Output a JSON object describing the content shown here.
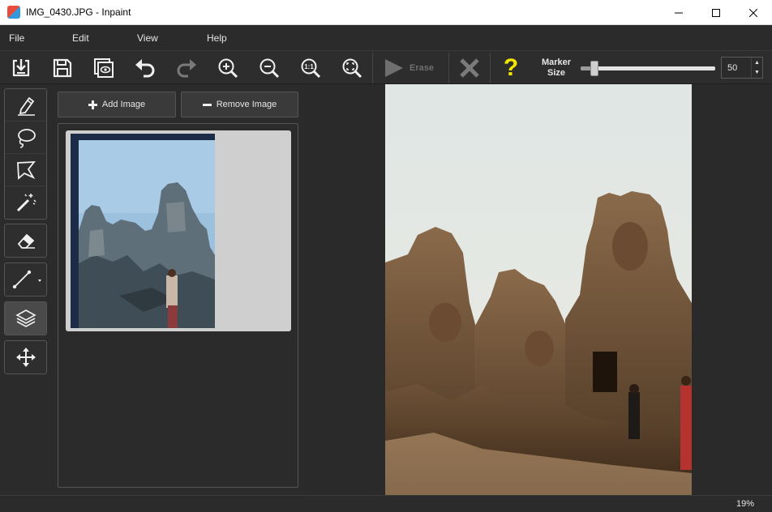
{
  "window": {
    "title": "IMG_0430.JPG - Inpaint",
    "minimize": "—",
    "maximize": "☐",
    "close": "✕"
  },
  "menu": {
    "items": [
      {
        "label": "File"
      },
      {
        "label": "Edit"
      },
      {
        "label": "View"
      },
      {
        "label": "Help"
      }
    ]
  },
  "toolbar": {
    "erase_label": "Erase",
    "help_glyph": "?",
    "marker_label_line1": "Marker",
    "marker_label_line2": "Size",
    "marker_size": "50",
    "marker_size_fraction": 0.1,
    "zoom_actual_label": "1:1"
  },
  "panel": {
    "add_label": "Add Image",
    "remove_label": "Remove Image"
  },
  "status": {
    "zoom": "19%"
  },
  "colors": {
    "background": "#2b2b2b",
    "help_yellow": "#f3e600",
    "erase_disabled": "#6f6f6f"
  }
}
